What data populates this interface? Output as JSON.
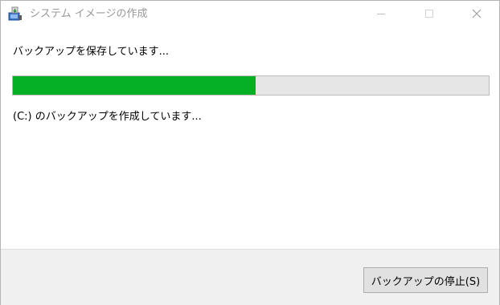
{
  "window": {
    "title": "システム イメージの作成",
    "icon": "system-image-backup-icon",
    "controls": {
      "minimize_icon": "minimize-icon",
      "maximize_icon": "maximize-icon",
      "close_icon": "close-icon"
    }
  },
  "main": {
    "status": "バックアップを保存しています...",
    "progress": {
      "fraction": 0.51,
      "fill_color": "#06b025",
      "track_color": "#e6e6e6"
    },
    "detail": "(C:) のバックアップを作成しています..."
  },
  "footer": {
    "stop_button_label": "バックアップの停止(S)"
  }
}
